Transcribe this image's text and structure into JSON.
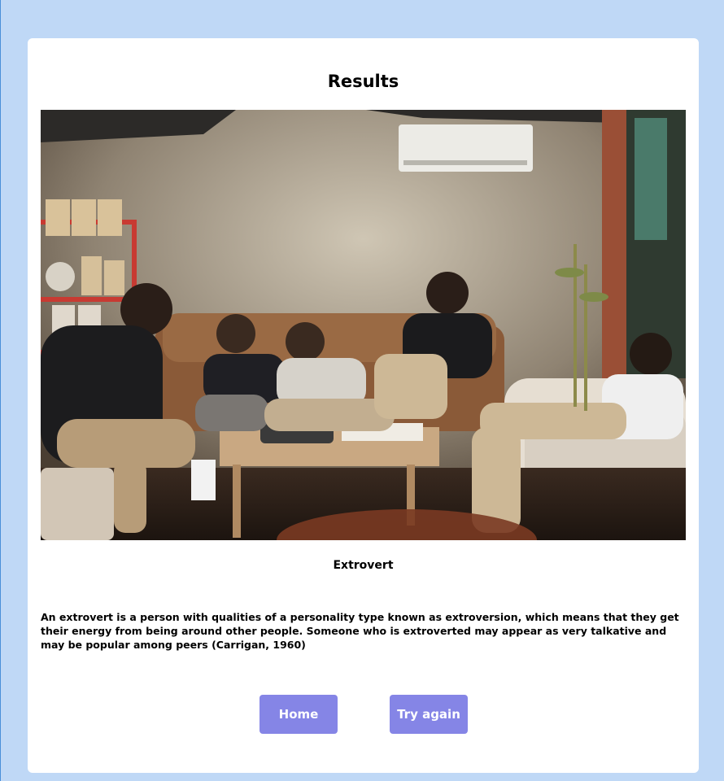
{
  "page": {
    "title": "Results"
  },
  "result": {
    "type": "Extrovert",
    "description": "An extrovert is a person with qualities of a personality type known as extroversion, which means that they get their energy from being around other people. Someone who is extroverted may appear as very talkative and may be popular among peers (Carrigan, 1960)"
  },
  "buttons": {
    "home_label": "Home",
    "try_again_label": "Try again"
  },
  "colors": {
    "background": "#bfd8f6",
    "card": "#ffffff",
    "button": "#8585e6",
    "button_text": "#ffffff"
  }
}
